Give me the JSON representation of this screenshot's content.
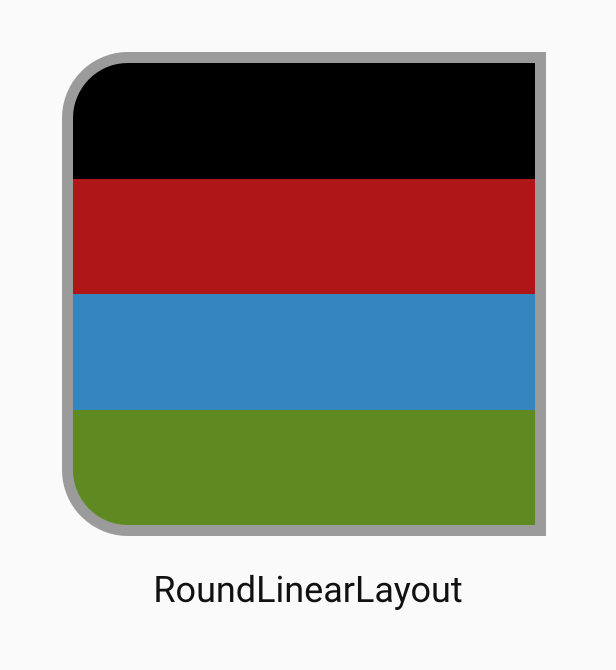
{
  "layout": {
    "border_color": "#9b9b9b",
    "stripes": [
      {
        "name": "black-stripe",
        "color": "#000000"
      },
      {
        "name": "red-stripe",
        "color": "#ae1618"
      },
      {
        "name": "blue-stripe",
        "color": "#3585be"
      },
      {
        "name": "green-stripe",
        "color": "#5f8a22"
      }
    ]
  },
  "caption": {
    "label": "RoundLinearLayout"
  }
}
